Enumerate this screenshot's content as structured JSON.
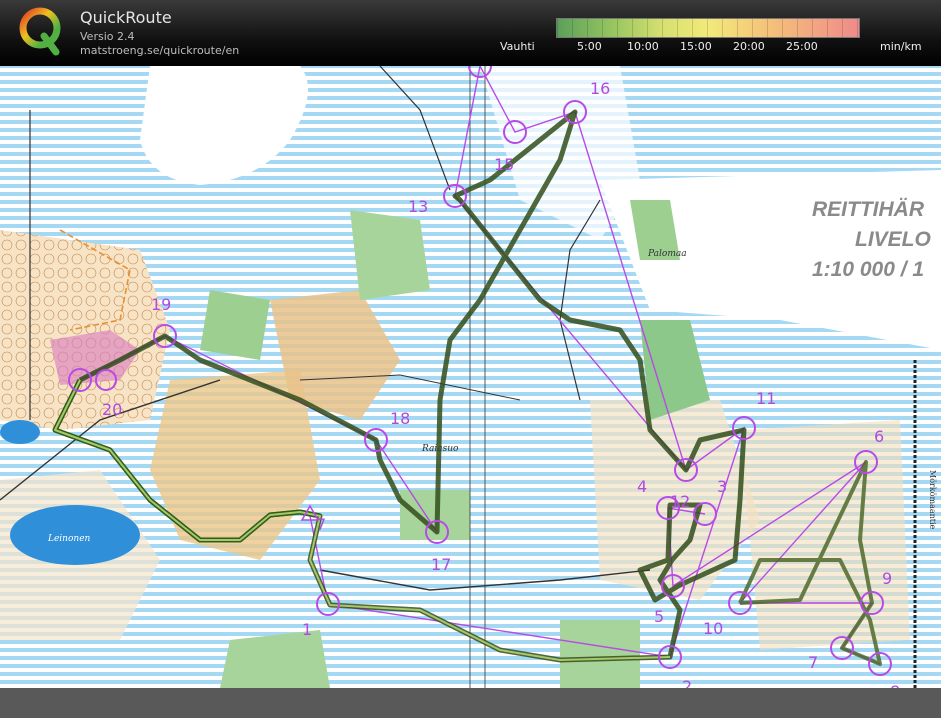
{
  "app": {
    "name": "QuickRoute",
    "version": "Versio 2.4",
    "url": "matstroeng.se/quickroute/en"
  },
  "pace_scale": {
    "label": "Vauhti",
    "ticks": [
      "5:00",
      "10:00",
      "15:00",
      "20:00",
      "25:00"
    ],
    "unit": "min/km"
  },
  "map": {
    "title_lines": [
      "REITTIHÄR",
      "LIVELO",
      "1:10 000 / 1"
    ],
    "place_names": [
      "Palomaa",
      "Raiasuo",
      "Leinonen",
      "Mörkömaantie"
    ]
  },
  "controls": [
    {
      "label": "1"
    },
    {
      "label": "2"
    },
    {
      "label": "3"
    },
    {
      "label": "4"
    },
    {
      "label": "5"
    },
    {
      "label": "6"
    },
    {
      "label": "7"
    },
    {
      "label": "8"
    },
    {
      "label": "9"
    },
    {
      "label": "10"
    },
    {
      "label": "11"
    },
    {
      "label": "12"
    },
    {
      "label": "13"
    },
    {
      "label": "15"
    },
    {
      "label": "16"
    },
    {
      "label": "17"
    },
    {
      "label": "18"
    },
    {
      "label": "19"
    },
    {
      "label": "20"
    },
    {
      "label": "7"
    }
  ],
  "colors": {
    "course": "#b84ae6",
    "route": "#4e6a2a",
    "water": "#3aa8e0",
    "forest_green": "#8cc88a",
    "open_land": "#e8b878"
  }
}
